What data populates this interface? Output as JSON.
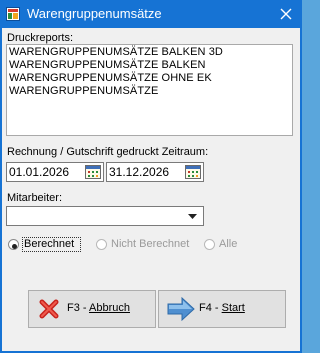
{
  "window": {
    "title": "Warengruppenumsätze",
    "close_symbol": "✕",
    "title_color": "#1673d4"
  },
  "reports": {
    "label": "Druckreports:",
    "items": [
      "WARENGRUPPENUMSÄTZE BALKEN 3D",
      "WARENGRUPPENUMSÄTZE BALKEN",
      "WARENGRUPPENUMSÄTZE OHNE EK",
      "WARENGRUPPENUMSÄTZE"
    ]
  },
  "period": {
    "label": "Rechnung / Gutschrift gedruckt Zeitraum:",
    "from": "01.01.2026",
    "to": "31.12.2026"
  },
  "employee": {
    "label": "Mitarbeiter:",
    "value": ""
  },
  "filter": {
    "options": [
      {
        "label": "Berechnet",
        "selected": true,
        "enabled": true
      },
      {
        "label": "Nicht Berechnet",
        "selected": false,
        "enabled": false
      },
      {
        "label": "Alle",
        "selected": false,
        "enabled": false
      }
    ]
  },
  "buttons": {
    "cancel_key": "F3 - ",
    "cancel_word": "Abbruch",
    "start_key": "F4 - ",
    "start_word": "Start"
  },
  "icons": {
    "title": "app-icon",
    "close": "close-icon",
    "calendar": "calendar-icon",
    "dropdown": "chevron-down-icon",
    "cancel": "red-x-icon",
    "start": "arrow-right-icon"
  }
}
